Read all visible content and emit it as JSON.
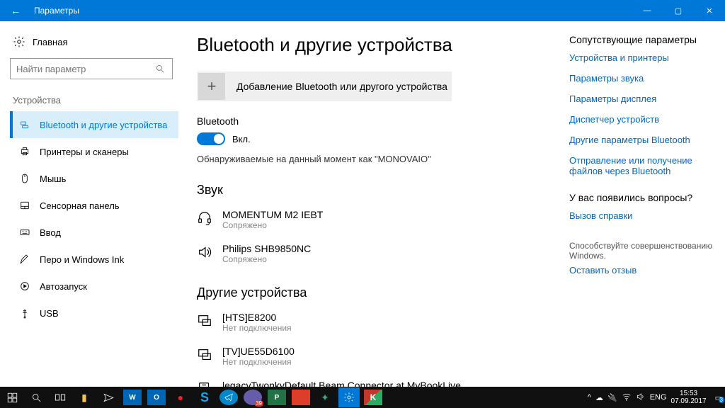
{
  "titlebar": {
    "title": "Параметры"
  },
  "home": "Главная",
  "search_placeholder": "Найти параметр",
  "category": "Устройства",
  "nav": [
    {
      "label": "Bluetooth и другие устройства"
    },
    {
      "label": "Принтеры и сканеры"
    },
    {
      "label": "Мышь"
    },
    {
      "label": "Сенсорная панель"
    },
    {
      "label": "Ввод"
    },
    {
      "label": "Перо и Windows Ink"
    },
    {
      "label": "Автозапуск"
    },
    {
      "label": "USB"
    }
  ],
  "page_title": "Bluetooth и другие устройства",
  "add_device": "Добавление Bluetooth или другого устройства",
  "bt_label": "Bluetooth",
  "bt_state": "Вкл.",
  "discoverable": "Обнаруживаемые на данный момент как \"MONOVAIO\"",
  "sec_audio": "Звук",
  "audio_devs": [
    {
      "name": "MOMENTUM M2 IEBT",
      "status": "Сопряжено"
    },
    {
      "name": "Philips SHB9850NC",
      "status": "Сопряжено"
    }
  ],
  "sec_other": "Другие устройства",
  "other_devs": [
    {
      "name": "[HTS]E8200",
      "status": "Нет подключения"
    },
    {
      "name": "[TV]UE55D6100",
      "status": "Нет подключения"
    },
    {
      "name": "legacyTwonkyDefault Beam Connector at MyBookLive",
      "status": ""
    }
  ],
  "right": {
    "hdr": "Сопутствующие параметры",
    "links": [
      "Устройства и принтеры",
      "Параметры звука",
      "Параметры дисплея",
      "Диспетчер устройств",
      "Другие параметры Bluetooth",
      "Отправление или получение файлов через Bluetooth"
    ],
    "q_hdr": "У вас появились вопросы?",
    "q_link": "Вызов справки",
    "f_hdr": "Способствуйте совершенствованию Windows.",
    "f_link": "Оставить отзыв"
  },
  "tray": {
    "lang": "ENG",
    "time": "15:53",
    "date": "07.09.2017",
    "badge": "3"
  }
}
